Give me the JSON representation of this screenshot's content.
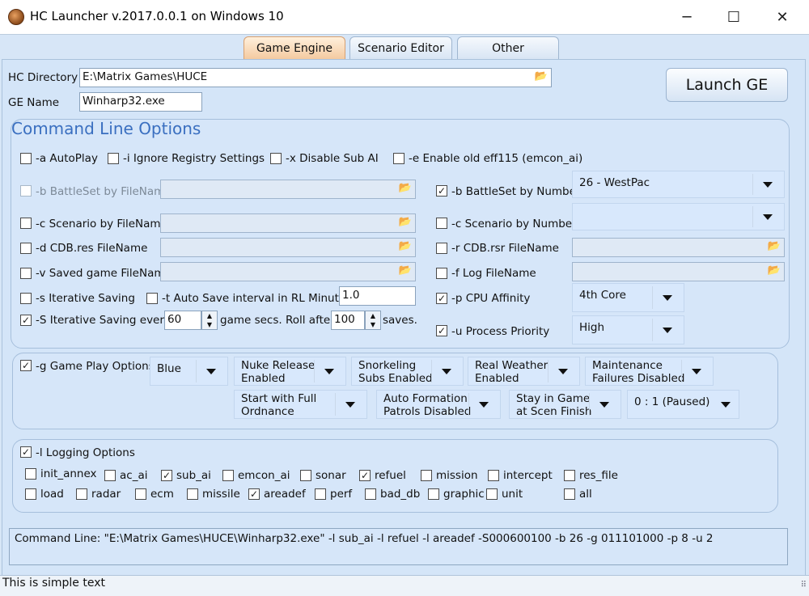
{
  "window": {
    "title": "HC Launcher v.2017.0.0.1 on Windows 10",
    "minimize": "─",
    "maximize": "☐",
    "close": "✕"
  },
  "tabs": [
    "Game Engine",
    "Scenario Editor",
    "Other"
  ],
  "hc_directory": {
    "label": "HC Directory",
    "value": "E:\\Matrix Games\\HUCE"
  },
  "ge_name": {
    "label": "GE Name",
    "value": "Winharp32.exe"
  },
  "launch_button": "Launch GE",
  "command_line_options": {
    "title": "Command Line Options",
    "autoplay": "-a AutoPlay",
    "ignore_registry": "-i Ignore Registry Settings",
    "disable_sub_ai": "-x Disable Sub AI",
    "old_eff115": "-e Enable old eff115 (emcon_ai)",
    "battleset_file": "-b BattleSet by FileName",
    "battleset_number": "-b BattleSet by Number",
    "battleset_number_value": "26 - WestPac",
    "scenario_file": "-c Scenario by FileName",
    "scenario_number": "-c Scenario by Number",
    "cdb_res": "-d CDB.res FileName",
    "cdb_rsr": "-r CDB.rsr FileName",
    "saved_game": "-v Saved game FileName",
    "log_file": "-f Log FileName",
    "iterative_saving": "-s Iterative Saving",
    "auto_save": "-t Auto Save interval in RL Minutes",
    "auto_save_value": "1.0",
    "cpu_affinity": "-p CPU Affinity",
    "cpu_affinity_value": "4th Core",
    "iter_every": "-S Iterative Saving every",
    "iter_every_value": "60",
    "game_secs": "game secs.  Roll after",
    "roll_value": "100",
    "saves": "saves.",
    "process_priority": "-u Process Priority",
    "process_priority_value": "High"
  },
  "game_play": {
    "label": "-g Game Play Options",
    "side": "Blue",
    "nuke": [
      "Nuke Release",
      "Enabled"
    ],
    "snorkel": [
      "Snorkeling",
      "Subs Enabled"
    ],
    "weather": [
      "Real Weather",
      "Enabled"
    ],
    "maint": [
      "Maintenance",
      "Failures Disabled"
    ],
    "ordnance": [
      "Start with Full",
      "Ordnance"
    ],
    "autoform": [
      "Auto Formation",
      "Patrols Disabled"
    ],
    "stay": [
      "Stay in Game",
      "at Scen Finish"
    ],
    "ratio": "0 : 1 (Paused)"
  },
  "logging": {
    "label": "-l Logging Options",
    "items": [
      "init_annex",
      "ac_ai",
      "sub_ai",
      "emcon_ai",
      "sonar",
      "refuel",
      "mission",
      "intercept",
      "res_file",
      "load",
      "radar",
      "ecm",
      "missile",
      "areadef",
      "perf",
      "bad_db",
      "graphic",
      "unit",
      "all"
    ]
  },
  "command_line": "Command Line: \"E:\\Matrix Games\\HUCE\\Winharp32.exe\" -l sub_ai -l refuel -l areadef -S000600100 -b 26 -g 011101000 -p 8 -u 2",
  "status": "This is simple text",
  "checked_mark": "✓",
  "folder_icon": "📂"
}
